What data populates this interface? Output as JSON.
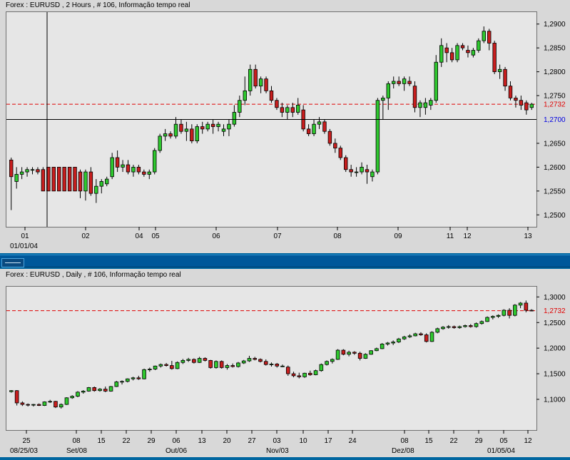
{
  "window": {
    "top_title": "Forex : EURUSD , 2 Hours , # 106, Informação tempo real",
    "bottom_title": "Forex : EURUSD , Daily , # 106, Informação tempo real"
  },
  "colors": {
    "bull": "#2ec82e",
    "bear": "#c81e1e",
    "grid_dash": "#e00000",
    "crosshair": "#000000",
    "plot_bg": "#e6e6e6"
  },
  "chart_data": [
    {
      "type": "candlestick",
      "title": "Forex : EURUSD , 2 Hours , # 106, Informação tempo real",
      "ylim": [
        1.2475,
        1.2925
      ],
      "yticks": [
        "1,2900",
        "1,2850",
        "1,2800",
        "1,2750",
        "1,2650",
        "1,2600",
        "1,2550",
        "1,2500"
      ],
      "ytick_values": [
        1.29,
        1.285,
        1.28,
        1.275,
        1.265,
        1.26,
        1.255,
        1.25
      ],
      "current_price_label": "1,2732",
      "current_price": 1.2732,
      "cursor_price_label": "1,2700",
      "cursor_price": 1.27,
      "xtick_labels": [
        "01",
        "02",
        "04",
        "05",
        "06",
        "07",
        "08",
        "09",
        "11",
        "12",
        "13"
      ],
      "date_label": "01/01/04",
      "candles": [
        [
          1.2615,
          1.262,
          1.251,
          1.258
        ],
        [
          1.257,
          1.26,
          1.2555,
          1.2585
        ],
        [
          1.2585,
          1.26,
          1.2575,
          1.259
        ],
        [
          1.259,
          1.26,
          1.258,
          1.2595
        ],
        [
          1.2595,
          1.26,
          1.2585,
          1.2595
        ],
        [
          1.2595,
          1.26,
          1.2585,
          1.259
        ],
        [
          1.2595,
          1.26,
          1.255,
          1.255
        ],
        [
          1.26,
          1.26,
          1.255,
          1.255
        ],
        [
          1.26,
          1.26,
          1.255,
          1.255
        ],
        [
          1.26,
          1.26,
          1.255,
          1.255
        ],
        [
          1.26,
          1.26,
          1.255,
          1.255
        ],
        [
          1.26,
          1.26,
          1.255,
          1.255
        ],
        [
          1.26,
          1.26,
          1.255,
          1.255
        ],
        [
          1.259,
          1.2595,
          1.2535,
          1.255
        ],
        [
          1.255,
          1.2595,
          1.253,
          1.259
        ],
        [
          1.259,
          1.26,
          1.254,
          1.2545
        ],
        [
          1.2545,
          1.2575,
          1.2525,
          1.256
        ],
        [
          1.256,
          1.2575,
          1.2545,
          1.257
        ],
        [
          1.2565,
          1.258,
          1.256,
          1.2575
        ],
        [
          1.258,
          1.263,
          1.2575,
          1.262
        ],
        [
          1.262,
          1.2635,
          1.259,
          1.26
        ],
        [
          1.26,
          1.2615,
          1.259,
          1.2605
        ],
        [
          1.2605,
          1.2615,
          1.2585,
          1.259
        ],
        [
          1.259,
          1.2605,
          1.258,
          1.26
        ],
        [
          1.26,
          1.2605,
          1.2585,
          1.259
        ],
        [
          1.259,
          1.2595,
          1.258,
          1.2585
        ],
        [
          1.2585,
          1.2595,
          1.2575,
          1.259
        ],
        [
          1.259,
          1.264,
          1.2585,
          1.2635
        ],
        [
          1.2635,
          1.267,
          1.263,
          1.2665
        ],
        [
          1.2665,
          1.268,
          1.2655,
          1.267
        ],
        [
          1.267,
          1.2675,
          1.266,
          1.2665
        ],
        [
          1.2665,
          1.2705,
          1.266,
          1.269
        ],
        [
          1.269,
          1.27,
          1.267,
          1.2675
        ],
        [
          1.2675,
          1.2695,
          1.2655,
          1.268
        ],
        [
          1.268,
          1.269,
          1.265,
          1.2655
        ],
        [
          1.2655,
          1.269,
          1.265,
          1.2685
        ],
        [
          1.2685,
          1.2695,
          1.267,
          1.268
        ],
        [
          1.268,
          1.2695,
          1.2675,
          1.269
        ],
        [
          1.269,
          1.27,
          1.267,
          1.2685
        ],
        [
          1.2685,
          1.2695,
          1.2675,
          1.269
        ],
        [
          1.2675,
          1.269,
          1.2665,
          1.268
        ],
        [
          1.268,
          1.27,
          1.2665,
          1.269
        ],
        [
          1.269,
          1.273,
          1.2685,
          1.2715
        ],
        [
          1.2715,
          1.275,
          1.2705,
          1.274
        ],
        [
          1.274,
          1.279,
          1.273,
          1.276
        ],
        [
          1.276,
          1.2815,
          1.275,
          1.2805
        ],
        [
          1.2805,
          1.2815,
          1.2765,
          1.277
        ],
        [
          1.277,
          1.279,
          1.2755,
          1.2785
        ],
        [
          1.2785,
          1.279,
          1.2755,
          1.276
        ],
        [
          1.276,
          1.277,
          1.2735,
          1.274
        ],
        [
          1.274,
          1.2745,
          1.272,
          1.2725
        ],
        [
          1.2725,
          1.2735,
          1.2705,
          1.2715
        ],
        [
          1.2715,
          1.273,
          1.27,
          1.2725
        ],
        [
          1.2725,
          1.2735,
          1.2705,
          1.2715
        ],
        [
          1.2715,
          1.2745,
          1.271,
          1.273
        ],
        [
          1.272,
          1.273,
          1.2675,
          1.268
        ],
        [
          1.268,
          1.269,
          1.2665,
          1.267
        ],
        [
          1.267,
          1.27,
          1.2665,
          1.269
        ],
        [
          1.269,
          1.2705,
          1.268,
          1.2695
        ],
        [
          1.2695,
          1.27,
          1.267,
          1.2675
        ],
        [
          1.2675,
          1.268,
          1.2645,
          1.265
        ],
        [
          1.265,
          1.266,
          1.263,
          1.264
        ],
        [
          1.264,
          1.2645,
          1.2615,
          1.262
        ],
        [
          1.262,
          1.2625,
          1.259,
          1.2595
        ],
        [
          1.2595,
          1.2605,
          1.258,
          1.259
        ],
        [
          1.259,
          1.26,
          1.258,
          1.259
        ],
        [
          1.259,
          1.261,
          1.2585,
          1.26
        ],
        [
          1.2595,
          1.2605,
          1.2565,
          1.259
        ],
        [
          1.258,
          1.2595,
          1.257,
          1.259
        ],
        [
          1.259,
          1.2745,
          1.2585,
          1.274
        ],
        [
          1.274,
          1.275,
          1.27,
          1.2745
        ],
        [
          1.2745,
          1.278,
          1.272,
          1.2775
        ],
        [
          1.2775,
          1.279,
          1.2765,
          1.278
        ],
        [
          1.278,
          1.279,
          1.277,
          1.2775
        ],
        [
          1.2775,
          1.279,
          1.276,
          1.2785
        ],
        [
          1.278,
          1.279,
          1.277,
          1.2775
        ],
        [
          1.277,
          1.278,
          1.2715,
          1.2725
        ],
        [
          1.2725,
          1.274,
          1.2705,
          1.2735
        ],
        [
          1.2725,
          1.2745,
          1.271,
          1.2735
        ],
        [
          1.273,
          1.2745,
          1.272,
          1.274
        ],
        [
          1.274,
          1.2835,
          1.2735,
          1.282
        ],
        [
          1.282,
          1.287,
          1.281,
          1.2855
        ],
        [
          1.285,
          1.286,
          1.282,
          1.284
        ],
        [
          1.284,
          1.285,
          1.282,
          1.2825
        ],
        [
          1.2825,
          1.286,
          1.282,
          1.2855
        ],
        [
          1.2855,
          1.286,
          1.2845,
          1.285
        ],
        [
          1.2845,
          1.2855,
          1.283,
          1.284
        ],
        [
          1.2835,
          1.285,
          1.283,
          1.2845
        ],
        [
          1.2845,
          1.287,
          1.284,
          1.2865
        ],
        [
          1.2865,
          1.2895,
          1.286,
          1.2885
        ],
        [
          1.2885,
          1.289,
          1.2845,
          1.286
        ],
        [
          1.286,
          1.2865,
          1.2795,
          1.28
        ],
        [
          1.28,
          1.2815,
          1.2785,
          1.2805
        ],
        [
          1.2805,
          1.281,
          1.276,
          1.277
        ],
        [
          1.277,
          1.278,
          1.274,
          1.2745
        ],
        [
          1.2745,
          1.275,
          1.2725,
          1.274
        ],
        [
          1.274,
          1.275,
          1.272,
          1.273
        ],
        [
          1.2735,
          1.274,
          1.271,
          1.272
        ],
        [
          1.2725,
          1.2735,
          1.272,
          1.2732
        ]
      ]
    },
    {
      "type": "candlestick",
      "title": "Forex : EURUSD , Daily , # 106, Informação tempo real",
      "ylim": [
        1.04,
        1.32
      ],
      "yticks": [
        "1,3000",
        "1,2500",
        "1,2000",
        "1,1500",
        "1,1000"
      ],
      "ytick_values": [
        1.3,
        1.25,
        1.2,
        1.15,
        1.1
      ],
      "current_price_label": "1,2732",
      "current_price": 1.2732,
      "xtick_labels": [
        "25",
        "08",
        "15",
        "22",
        "29",
        "06",
        "13",
        "20",
        "27",
        "03",
        "10",
        "17",
        "24",
        "08",
        "15",
        "22",
        "29",
        "05",
        "12"
      ],
      "month_labels": [
        "08/25/03",
        "Set/08",
        "Out/06",
        "Nov/03",
        "Dez/08",
        "01/05/04"
      ],
      "candles": [
        [
          1.115,
          1.118,
          1.113,
          1.117
        ],
        [
          1.117,
          1.118,
          1.088,
          1.093
        ],
        [
          1.093,
          1.096,
          1.087,
          1.09
        ],
        [
          1.09,
          1.092,
          1.086,
          1.089
        ],
        [
          1.089,
          1.091,
          1.086,
          1.09
        ],
        [
          1.09,
          1.092,
          1.087,
          1.088
        ],
        [
          1.088,
          1.096,
          1.087,
          1.095
        ],
        [
          1.095,
          1.099,
          1.093,
          1.096
        ],
        [
          1.096,
          1.097,
          1.083,
          1.085
        ],
        [
          1.085,
          1.092,
          1.082,
          1.09
        ],
        [
          1.09,
          1.104,
          1.089,
          1.103
        ],
        [
          1.103,
          1.108,
          1.101,
          1.106
        ],
        [
          1.106,
          1.116,
          1.104,
          1.114
        ],
        [
          1.114,
          1.118,
          1.111,
          1.116
        ],
        [
          1.116,
          1.124,
          1.115,
          1.123
        ],
        [
          1.123,
          1.125,
          1.115,
          1.117
        ],
        [
          1.117,
          1.122,
          1.115,
          1.12
        ],
        [
          1.12,
          1.125,
          1.114,
          1.116
        ],
        [
          1.116,
          1.126,
          1.115,
          1.125
        ],
        [
          1.125,
          1.136,
          1.124,
          1.134
        ],
        [
          1.134,
          1.137,
          1.129,
          1.135
        ],
        [
          1.135,
          1.141,
          1.133,
          1.14
        ],
        [
          1.14,
          1.144,
          1.137,
          1.142
        ],
        [
          1.142,
          1.146,
          1.138,
          1.14
        ],
        [
          1.14,
          1.16,
          1.139,
          1.158
        ],
        [
          1.158,
          1.162,
          1.154,
          1.159
        ],
        [
          1.159,
          1.166,
          1.157,
          1.165
        ],
        [
          1.165,
          1.17,
          1.162,
          1.168
        ],
        [
          1.168,
          1.171,
          1.164,
          1.166
        ],
        [
          1.166,
          1.175,
          1.158,
          1.16
        ],
        [
          1.16,
          1.174,
          1.159,
          1.172
        ],
        [
          1.172,
          1.179,
          1.169,
          1.176
        ],
        [
          1.176,
          1.181,
          1.173,
          1.178
        ],
        [
          1.178,
          1.18,
          1.17,
          1.172
        ],
        [
          1.172,
          1.183,
          1.171,
          1.18
        ],
        [
          1.18,
          1.182,
          1.174,
          1.176
        ],
        [
          1.176,
          1.177,
          1.16,
          1.162
        ],
        [
          1.162,
          1.176,
          1.16,
          1.174
        ],
        [
          1.174,
          1.176,
          1.16,
          1.162
        ],
        [
          1.162,
          1.169,
          1.158,
          1.166
        ],
        [
          1.166,
          1.17,
          1.162,
          1.164
        ],
        [
          1.164,
          1.173,
          1.162,
          1.171
        ],
        [
          1.171,
          1.177,
          1.169,
          1.175
        ],
        [
          1.175,
          1.185,
          1.173,
          1.18
        ],
        [
          1.18,
          1.183,
          1.176,
          1.178
        ],
        [
          1.178,
          1.18,
          1.172,
          1.174
        ],
        [
          1.174,
          1.178,
          1.166,
          1.168
        ],
        [
          1.168,
          1.172,
          1.164,
          1.169
        ],
        [
          1.169,
          1.171,
          1.162,
          1.165
        ],
        [
          1.165,
          1.168,
          1.163,
          1.165
        ],
        [
          1.163,
          1.166,
          1.146,
          1.15
        ],
        [
          1.15,
          1.154,
          1.143,
          1.146
        ],
        [
          1.146,
          1.152,
          1.141,
          1.144
        ],
        [
          1.144,
          1.152,
          1.142,
          1.151
        ],
        [
          1.151,
          1.156,
          1.146,
          1.148
        ],
        [
          1.148,
          1.158,
          1.147,
          1.156
        ],
        [
          1.156,
          1.17,
          1.154,
          1.168
        ],
        [
          1.168,
          1.176,
          1.166,
          1.174
        ],
        [
          1.174,
          1.18,
          1.17,
          1.178
        ],
        [
          1.178,
          1.198,
          1.177,
          1.196
        ],
        [
          1.196,
          1.198,
          1.186,
          1.188
        ],
        [
          1.188,
          1.195,
          1.184,
          1.192
        ],
        [
          1.192,
          1.194,
          1.187,
          1.19
        ],
        [
          1.19,
          1.193,
          1.176,
          1.18
        ],
        [
          1.18,
          1.19,
          1.179,
          1.188
        ],
        [
          1.188,
          1.196,
          1.187,
          1.195
        ],
        [
          1.195,
          1.201,
          1.194,
          1.199
        ],
        [
          1.199,
          1.21,
          1.198,
          1.208
        ],
        [
          1.208,
          1.212,
          1.205,
          1.21
        ],
        [
          1.21,
          1.215,
          1.206,
          1.212
        ],
        [
          1.212,
          1.22,
          1.21,
          1.218
        ],
        [
          1.218,
          1.224,
          1.216,
          1.222
        ],
        [
          1.222,
          1.227,
          1.22,
          1.224
        ],
        [
          1.224,
          1.23,
          1.223,
          1.228
        ],
        [
          1.228,
          1.231,
          1.224,
          1.226
        ],
        [
          1.226,
          1.229,
          1.211,
          1.213
        ],
        [
          1.213,
          1.233,
          1.212,
          1.231
        ],
        [
          1.231,
          1.24,
          1.229,
          1.238
        ],
        [
          1.238,
          1.243,
          1.236,
          1.241
        ],
        [
          1.241,
          1.245,
          1.238,
          1.242
        ],
        [
          1.242,
          1.244,
          1.238,
          1.24
        ],
        [
          1.24,
          1.244,
          1.238,
          1.242
        ],
        [
          1.242,
          1.246,
          1.24,
          1.244
        ],
        [
          1.244,
          1.247,
          1.24,
          1.242
        ],
        [
          1.242,
          1.25,
          1.24,
          1.248
        ],
        [
          1.248,
          1.254,
          1.246,
          1.252
        ],
        [
          1.252,
          1.262,
          1.251,
          1.26
        ],
        [
          1.26,
          1.264,
          1.256,
          1.262
        ],
        [
          1.262,
          1.266,
          1.259,
          1.264
        ],
        [
          1.264,
          1.276,
          1.262,
          1.274
        ],
        [
          1.274,
          1.278,
          1.258,
          1.264
        ],
        [
          1.264,
          1.286,
          1.262,
          1.284
        ],
        [
          1.284,
          1.29,
          1.278,
          1.288
        ],
        [
          1.288,
          1.293,
          1.27,
          1.274
        ],
        [
          1.274,
          1.276,
          1.272,
          1.2732
        ]
      ]
    }
  ]
}
